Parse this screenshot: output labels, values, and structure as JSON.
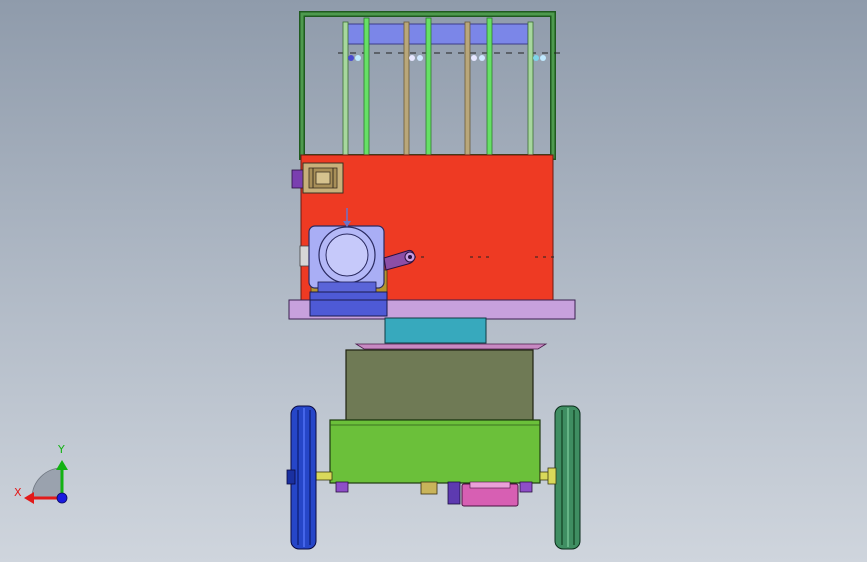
{
  "viewport": {
    "background_top": "#8f9bab",
    "background_bottom": "#cfd5dd"
  },
  "model": {
    "parts": [
      "top-frame",
      "blue-bar",
      "red-panel",
      "gear-motor",
      "crank-arm",
      "base-plate",
      "column",
      "chassis-box",
      "wheel-left",
      "wheel-right",
      "drive-pulley"
    ],
    "colors": {
      "frame": "#3d7a3d",
      "bar": "#7b86e8",
      "panel": "#ee3a23",
      "motor": "#a9aef5",
      "plate": "#c7a1dd",
      "column": "#37a9bd",
      "box_top": "#6f7a55",
      "box_bottom": "#6bc03a",
      "wheel_left": "#2646c8",
      "wheel_right": "#3f8e62",
      "pulley": "#d75fb3"
    }
  },
  "triad": {
    "x_label": "X",
    "y_label": "Y",
    "x_color": "#e21a1a",
    "y_color": "#13b213",
    "z_color": "#1a1ae0"
  }
}
